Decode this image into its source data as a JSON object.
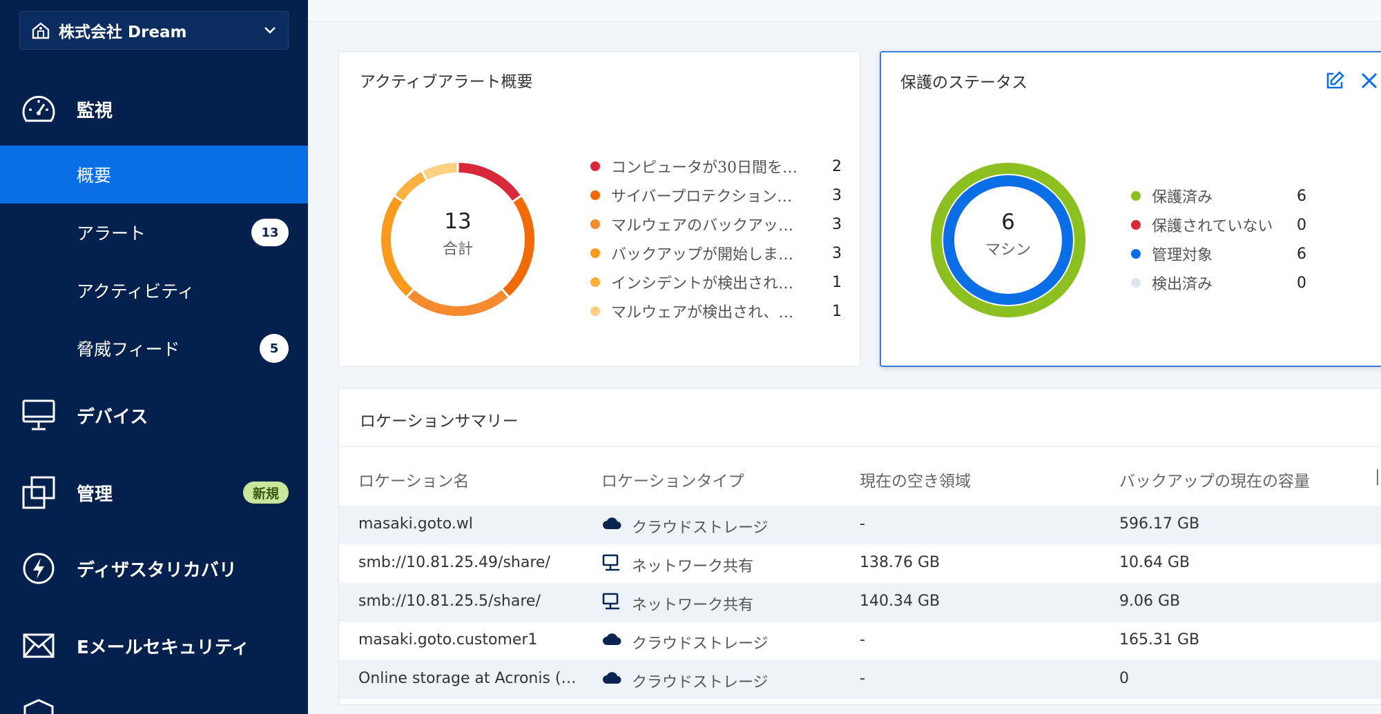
{
  "sidebar": {
    "tenant": "株式会社 Dream",
    "sections": {
      "monitor": "監視",
      "devices": "デバイス",
      "manage": "管理",
      "manage_badge": "新規",
      "disaster": "ディザスタリカバリ",
      "email": "Eメールセキュリティ"
    },
    "items": {
      "overview": "概要",
      "alerts": "アラート",
      "alerts_count": "13",
      "activity": "アクティビティ",
      "threat_feed": "脅威フィード",
      "threat_feed_count": "5"
    }
  },
  "alerts_card": {
    "title": "アクティブアラート概要",
    "total": "13",
    "total_label": "合計",
    "items": [
      {
        "label": "コンピュータが30日間を…",
        "value": "2",
        "color": "#d8283a"
      },
      {
        "label": "サイバープロテクション…",
        "value": "3",
        "color": "#f26a06"
      },
      {
        "label": "マルウェアのバックアッ…",
        "value": "3",
        "color": "#f68a2e"
      },
      {
        "label": "バックアップが開始しま…",
        "value": "3",
        "color": "#f99a1d"
      },
      {
        "label": "インシデントが検出され…",
        "value": "1",
        "color": "#fbb040"
      },
      {
        "label": "マルウェアが検出され、…",
        "value": "1",
        "color": "#fdd082"
      }
    ]
  },
  "protection_card": {
    "title": "保護のステータス",
    "total": "6",
    "total_label": "マシン",
    "items": [
      {
        "label": "保護済み",
        "value": "6",
        "color": "#8cc020"
      },
      {
        "label": "保護されていない",
        "value": "0",
        "color": "#d8283a"
      },
      {
        "label": "管理対象",
        "value": "6",
        "color": "#0a6ee6"
      },
      {
        "label": "検出済み",
        "value": "0",
        "color": "#dfe6ee"
      }
    ]
  },
  "location_card": {
    "title": "ロケーションサマリー",
    "columns": [
      "ロケーション名",
      "ロケーションタイプ",
      "現在の空き領域",
      "バックアップの現在の容量"
    ],
    "rows": [
      {
        "name": "masaki.goto.wl",
        "type": "クラウドストレージ",
        "icon": "cloud",
        "free": "-",
        "backup": "596.17 GB"
      },
      {
        "name": "smb://10.81.25.49/share/",
        "type": "ネットワーク共有",
        "icon": "network",
        "free": "138.76 GB",
        "backup": "10.64 GB"
      },
      {
        "name": "smb://10.81.25.5/share/",
        "type": "ネットワーク共有",
        "icon": "network",
        "free": "140.34 GB",
        "backup": "9.06 GB"
      },
      {
        "name": "masaki.goto.customer1",
        "type": "クラウドストレージ",
        "icon": "cloud",
        "free": "-",
        "backup": "165.31 GB"
      },
      {
        "name": "Online storage at Acronis (…",
        "type": "クラウドストレージ",
        "icon": "cloud",
        "free": "-",
        "backup": "0"
      }
    ]
  }
}
